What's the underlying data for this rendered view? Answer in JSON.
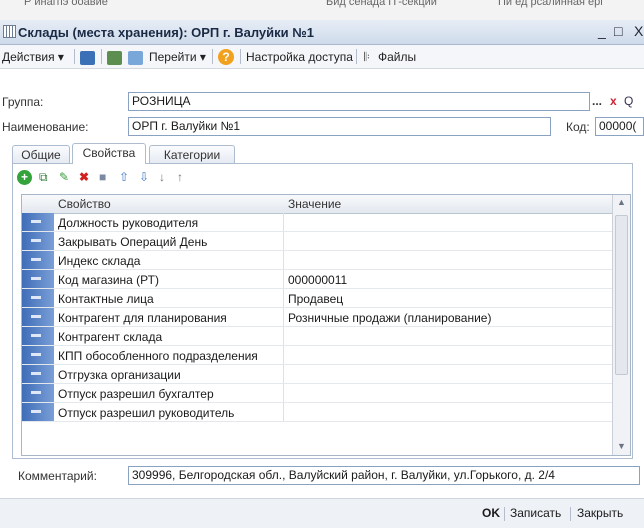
{
  "background_window": {
    "left_text": "Р инагпэ ооавие",
    "mid_text": "Бид сенада П'-секции",
    "right_text": "Пи ед рсалинная ерг"
  },
  "window": {
    "title": "Склады (места хранения): ОРП г. Валуйки №1",
    "minimize": "_",
    "maximize": "□",
    "close": "X"
  },
  "toolbar": {
    "actions": "Действия ▾",
    "goto": "Перейти ▾",
    "help": "?",
    "access": "Настройка доступа",
    "files": "Файлы"
  },
  "form": {
    "group_label": "Группа:",
    "group_value": "РОЗНИЦА",
    "group_btn_select": "...",
    "group_btn_clear": "x",
    "group_btn_search": "Q",
    "name_label": "Наименование:",
    "name_value": "ОРП г. Валуйки №1",
    "code_label": "Код:",
    "code_value": "00000("
  },
  "tabs": [
    {
      "label": "Общие"
    },
    {
      "label": "Свойства"
    },
    {
      "label": "Категории"
    }
  ],
  "active_tab": "Свойства",
  "table": {
    "columns": [
      "Свойство",
      "Значение"
    ],
    "rows": [
      {
        "property": "Должность руководителя",
        "value": ""
      },
      {
        "property": "Закрывать Операций День",
        "value": ""
      },
      {
        "property": "Индекс склада",
        "value": ""
      },
      {
        "property": "Код магазина (РТ)",
        "value": "000000011"
      },
      {
        "property": "Контактные лица",
        "value": "Продавец"
      },
      {
        "property": "Контрагент для планирования",
        "value": "Розничные продажи (планирование)"
      },
      {
        "property": "Контрагент склада",
        "value": ""
      },
      {
        "property": "КПП обособленного подразделения",
        "value": ""
      },
      {
        "property": "Отгрузка организации",
        "value": ""
      },
      {
        "property": "Отпуск разрешил бухгалтер",
        "value": ""
      },
      {
        "property": "Отпуск разрешил руководитель",
        "value": ""
      }
    ]
  },
  "comment": {
    "label": "Комментарий:",
    "value": "309996, Белгородская обл., Валуйский район, г. Валуйки, ул.Горького, д. 2/4"
  },
  "footer": {
    "ok": "OK",
    "save": "Записать",
    "close": "Закрыть"
  }
}
